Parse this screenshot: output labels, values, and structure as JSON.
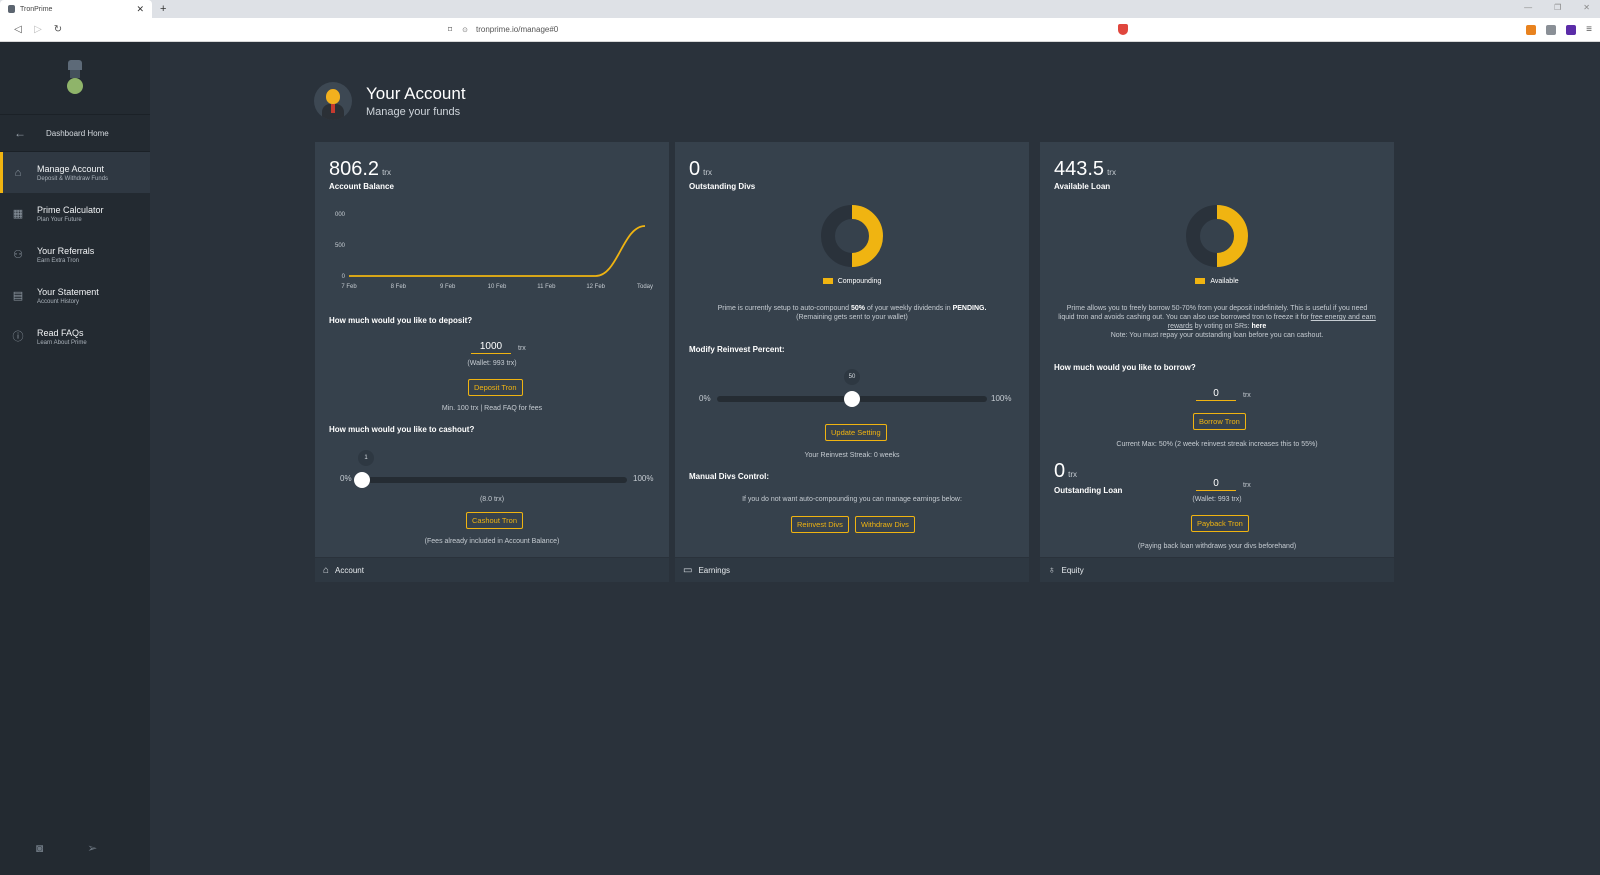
{
  "browser": {
    "tab_title": "TronPrime",
    "url": "tronprime.io/manage#0"
  },
  "sidebar": {
    "home": "Dashboard Home",
    "items": [
      {
        "title": "Manage Account",
        "sub": "Deposit & Withdraw Funds",
        "icon": "bank-icon"
      },
      {
        "title": "Prime Calculator",
        "sub": "Plan Your Future",
        "icon": "calculator-icon"
      },
      {
        "title": "Your Referrals",
        "sub": "Earn Extra Tron",
        "icon": "users-icon"
      },
      {
        "title": "Your Statement",
        "sub": "Account History",
        "icon": "document-icon"
      },
      {
        "title": "Read FAQs",
        "sub": "Learn About Prime",
        "icon": "info-icon"
      }
    ]
  },
  "header": {
    "title": "Your Account",
    "subtitle": "Manage your funds"
  },
  "account": {
    "balance": "806.2",
    "unit": "trx",
    "label": "Account Balance",
    "deposit_question": "How much would you like to deposit?",
    "deposit_value": "1000",
    "wallet_note": "(Wallet: 993 trx)",
    "deposit_button": "Deposit Tron",
    "deposit_note": "Min. 100 trx | Read FAQ for fees",
    "cashout_question": "How much would you like to cashout?",
    "slider_min": "0%",
    "slider_max": "100%",
    "slider_value_label": "1",
    "slider_value": 1,
    "cashout_amount": "(8.0 trx)",
    "cashout_button": "Cashout Tron",
    "cashout_note": "(Fees already included in Account Balance)",
    "footer": "Account"
  },
  "earnings": {
    "divs": "0",
    "unit": "trx",
    "label": "Outstanding Divs",
    "legend": "Compounding",
    "setup_pre": "Prime is currently setup to auto-compound ",
    "setup_pct": "50%",
    "setup_mid": " of your weekly dividends in ",
    "setup_state": "PENDING.",
    "setup_post": "(Remaining gets sent to your wallet)",
    "modify_label": "Modify Reinvest Percent:",
    "slider_min": "0%",
    "slider_max": "100%",
    "slider_value_label": "50",
    "slider_value": 50,
    "update_button": "Update Setting",
    "streak": "Your Reinvest Streak: 0 weeks",
    "manual_label": "Manual Divs Control:",
    "manual_note": "If you do not want auto-compounding you can manage earnings below:",
    "reinvest_button": "Reinvest Divs",
    "withdraw_button": "Withdraw Divs",
    "footer": "Earnings"
  },
  "equity": {
    "loan": "443.5",
    "unit": "trx",
    "label": "Available Loan",
    "legend": "Available",
    "info_1": "Prime allows you to freely borrow 50-70% from your deposit indefinitely. This is useful if you need liquid tron and avoids cashing out. You can also use borrowed tron to freeze it for ",
    "info_link": "free energy and earn rewards",
    "info_2": " by voting on SRs: ",
    "info_here": "here",
    "info_note": "Note: You must repay your outstanding loan before you can cashout.",
    "borrow_question": "How much would you like to borrow?",
    "borrow_value": "0",
    "borrow_button": "Borrow Tron",
    "current_max": "Current Max: 50% (2 week reinvest streak increases this to 55%)",
    "outstanding": "0",
    "outstanding_label": "Outstanding Loan",
    "payback_value": "0",
    "wallet_note": "(Wallet: 993 trx)",
    "payback_button": "Payback Tron",
    "payback_note": "(Paying back loan withdraws your divs beforehand)",
    "footer": "Equity"
  },
  "colors": {
    "accent": "#f0b411",
    "card": "#36414c",
    "background": "#2a323b"
  },
  "chart_data": [
    {
      "type": "line",
      "categories": [
        "7 Feb",
        "8 Feb",
        "9 Feb",
        "10 Feb",
        "11 Feb",
        "12 Feb",
        "Today"
      ],
      "values": [
        0,
        0,
        0,
        0,
        0,
        0,
        806.2
      ],
      "yticks": [
        "1000",
        "500",
        "0"
      ],
      "ylim": [
        0,
        1000
      ],
      "grid": false
    },
    {
      "type": "pie",
      "title": "Compounding",
      "values": [
        50,
        50
      ]
    },
    {
      "type": "pie",
      "title": "Available",
      "values": [
        50,
        50
      ]
    }
  ]
}
